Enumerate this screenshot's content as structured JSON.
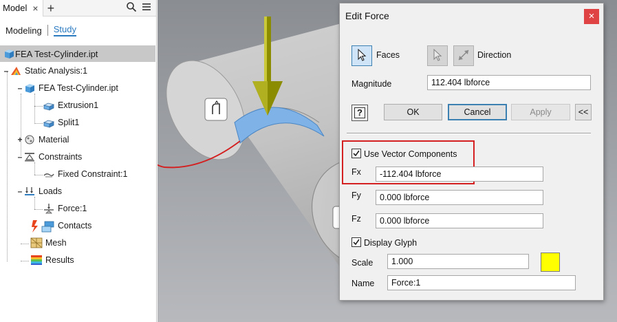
{
  "browser": {
    "tab_label": "Model",
    "close_glyph": "×",
    "add_glyph": "+",
    "subtabs": {
      "modeling": "Modeling",
      "study": "Study"
    },
    "root": "FEA Test-Cylinder.ipt",
    "tree": {
      "static_analysis": "Static Analysis:1",
      "part": "FEA Test-Cylinder.ipt",
      "extrusion": "Extrusion1",
      "split": "Split1",
      "material": "Material",
      "constraints": "Constraints",
      "fixed_constraint": "Fixed Constraint:1",
      "loads": "Loads",
      "force": "Force:1",
      "contacts": "Contacts",
      "mesh": "Mesh",
      "results": "Results"
    }
  },
  "dialog": {
    "title": "Edit Force",
    "close_glyph": "×",
    "faces_label": "Faces",
    "direction_label": "Direction",
    "magnitude_label": "Magnitude",
    "magnitude_value": "112.404 lbforce",
    "help_glyph": "?",
    "ok_label": "OK",
    "cancel_label": "Cancel",
    "apply_label": "Apply",
    "expand_label": "<<",
    "use_vector_label": "Use Vector Components",
    "use_vector_checked": true,
    "fx_label": "Fx",
    "fx_value": "-112.404 lbforce",
    "fy_label": "Fy",
    "fy_value": "0.000 lbforce",
    "fz_label": "Fz",
    "fz_value": "0.000 lbforce",
    "display_glyph_label": "Display Glyph",
    "display_glyph_checked": true,
    "scale_label": "Scale",
    "scale_value": "1.000",
    "glyph_color": "#ffff00",
    "name_label": "Name",
    "name_value": "Force:1"
  },
  "colors": {
    "annotation_red": "#d42020",
    "selected_face_blue": "#7fb2e6",
    "force_arrow": "#8c8c00"
  }
}
